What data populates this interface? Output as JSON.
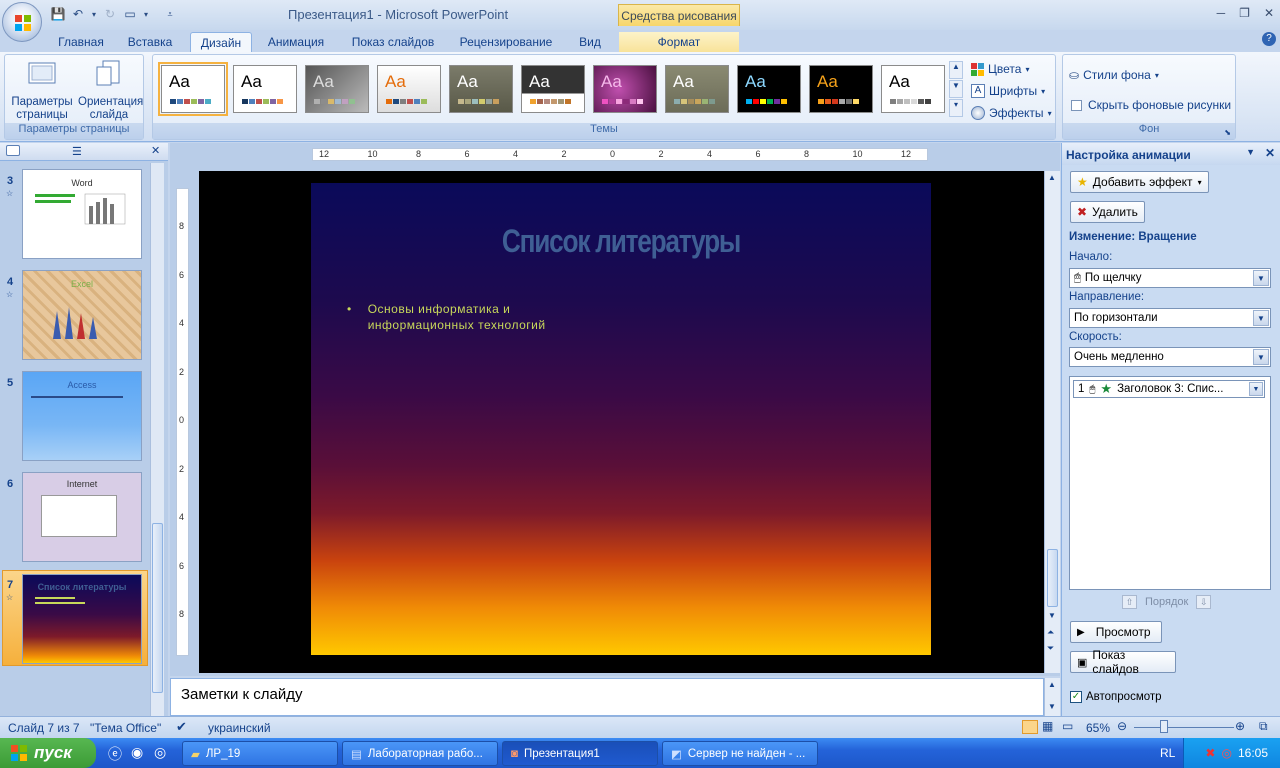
{
  "window": {
    "title": "Презентация1 - Microsoft PowerPoint",
    "context_tab": "Средства рисования"
  },
  "tabs": [
    "Главная",
    "Вставка",
    "Дизайн",
    "Анимация",
    "Показ слайдов",
    "Рецензирование",
    "Вид",
    "Формат"
  ],
  "active_tab": "Дизайн",
  "ribbon": {
    "page_setup": {
      "params_label": "Параметры страницы",
      "orientation_label": "Ориентация слайда",
      "group": "Параметры страницы"
    },
    "themes": {
      "group": "Темы",
      "aa": "Aa"
    },
    "theme_menu": {
      "colors": "Цвета",
      "fonts": "Шрифты",
      "effects": "Эффекты"
    },
    "background": {
      "styles": "Стили фона",
      "hide": "Скрыть фоновые рисунки",
      "group": "Фон"
    }
  },
  "slides": [
    {
      "num": "3",
      "title": "Word"
    },
    {
      "num": "4",
      "title": "Excel"
    },
    {
      "num": "5",
      "title": "Access"
    },
    {
      "num": "6",
      "title": "Internet"
    },
    {
      "num": "7",
      "title": "Список литературы"
    }
  ],
  "current_slide": {
    "title": "Список литературы",
    "bullet_marker": "•",
    "bullet_line1": "Основы информатика и",
    "bullet_line2": "информационных технологий"
  },
  "ruler": {
    "h_labels": [
      "12",
      "10",
      "8",
      "6",
      "4",
      "2",
      "0",
      "2",
      "4",
      "6",
      "8",
      "10",
      "12"
    ],
    "v_labels": [
      "8",
      "6",
      "4",
      "2",
      "0",
      "2",
      "4",
      "6",
      "8"
    ]
  },
  "notes": {
    "text": "Заметки к слайду"
  },
  "animation_pane": {
    "title": "Настройка анимации",
    "add_effect": "Добавить эффект",
    "remove": "Удалить",
    "change_label": "Изменение: Вращение",
    "start_label": "Начало:",
    "start_value": "По щелчку",
    "direction_label": "Направление:",
    "direction_value": "По горизонтали",
    "speed_label": "Скорость:",
    "speed_value": "Очень медленно",
    "list_item_num": "1",
    "list_item_text": "Заголовок 3: Спис...",
    "order_label": "Порядок",
    "preview": "Просмотр",
    "slideshow": "Показ слайдов",
    "autopreview": "Автопросмотр",
    "autopreview_checked": true
  },
  "status": {
    "slide_info": "Слайд 7 из 7",
    "theme": "\"Тема Office\"",
    "language": "украинский",
    "zoom": "65%"
  },
  "taskbar": {
    "start": "пуск",
    "items": [
      "ЛР_19",
      "Лабораторная рабо...",
      "Презентация1",
      "Сервер не найден - ..."
    ],
    "lang": "RL",
    "time": "16:05"
  }
}
